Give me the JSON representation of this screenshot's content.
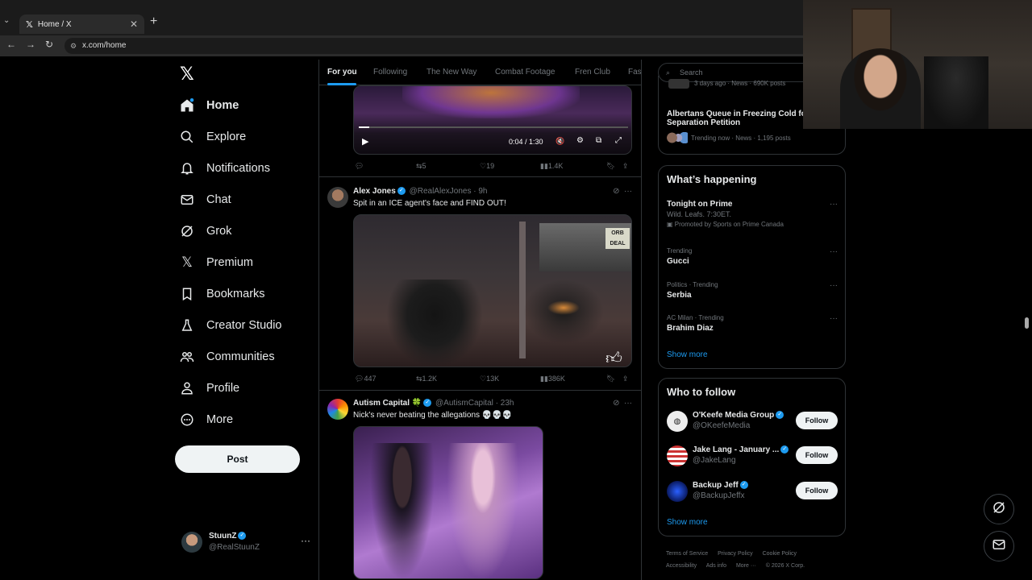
{
  "browser": {
    "tab_title": "Home / X",
    "url": "x.com/home"
  },
  "nav": {
    "items": [
      {
        "label": "Home",
        "icon": "home-icon"
      },
      {
        "label": "Explore",
        "icon": "search-icon"
      },
      {
        "label": "Notifications",
        "icon": "bell-icon"
      },
      {
        "label": "Chat",
        "icon": "mail-icon"
      },
      {
        "label": "Grok",
        "icon": "grok-icon"
      },
      {
        "label": "Premium",
        "icon": "x-icon"
      },
      {
        "label": "Bookmarks",
        "icon": "bookmark-icon"
      },
      {
        "label": "Creator Studio",
        "icon": "flask-icon"
      },
      {
        "label": "Communities",
        "icon": "people-icon"
      },
      {
        "label": "Profile",
        "icon": "person-icon"
      },
      {
        "label": "More",
        "icon": "more-circle-icon"
      }
    ],
    "post_label": "Post",
    "account": {
      "name": "StuunZ",
      "handle": "@RealStuunZ"
    }
  },
  "feed": {
    "tabs": [
      "For you",
      "Following",
      "The New Way",
      "Combat Footage",
      "Fren Club",
      "Fas"
    ],
    "video_player": {
      "time": "0:04 / 1:30",
      "progress": 0.04
    },
    "tweet0_actions": {
      "replies": "",
      "reposts": "5",
      "likes": "19",
      "views": "1.4K"
    },
    "tweet1": {
      "name": "Alex Jones",
      "handle": "@RealAlexJones · 9h",
      "text": "Spit in an ICE agent's face and FIND OUT!",
      "replies": "447",
      "reposts": "1.2K",
      "likes": "13K",
      "views": "386K"
    },
    "tweet2": {
      "name": "Autism Capital 🍀",
      "handle": "@AutismCapital · 23h",
      "text": "Nick's never beating the allegations 💀💀💀"
    }
  },
  "right": {
    "search_placeholder": "Search",
    "top_trend": {
      "partial": "3 days ago · News · 690K posts",
      "title": "Albertans Queue in Freezing Cold fo",
      "title2": "Separation Petition",
      "meta": "Trending now · News · 1,195 posts"
    },
    "happening": {
      "title": "What’s happening",
      "promo": {
        "title": "Tonight on Prime",
        "sub": "Wild. Leafs. 7:30ET.",
        "meta": "Promoted by Sports on Prime Canada"
      },
      "trends": [
        {
          "meta": "Trending",
          "title": "Gucci"
        },
        {
          "meta": "Politics · Trending",
          "title": "Serbia"
        },
        {
          "meta": "AC Milan · Trending",
          "title": "Brahim Diaz"
        }
      ],
      "show_more": "Show more"
    },
    "who_to_follow": {
      "title": "Who to follow",
      "accounts": [
        {
          "name": "O'Keefe Media Group",
          "handle": "@OKeefeMedia",
          "button": "Follow"
        },
        {
          "name": "Jake Lang - January ...",
          "handle": "@JakeLang",
          "button": "Follow"
        },
        {
          "name": "Backup Jeff",
          "handle": "@BackupJeffx",
          "button": "Follow"
        }
      ],
      "show_more": "Show more"
    },
    "footer": {
      "links": [
        "Terms of Service",
        "Privacy Policy",
        "Cookie Policy",
        "Accessibility",
        "Ads info",
        "More ···",
        "© 2026 X Corp."
      ]
    }
  },
  "colors": {
    "accent": "#1d9bf0",
    "background": "#000000",
    "border": "#2f3336",
    "muted": "#71767b"
  }
}
